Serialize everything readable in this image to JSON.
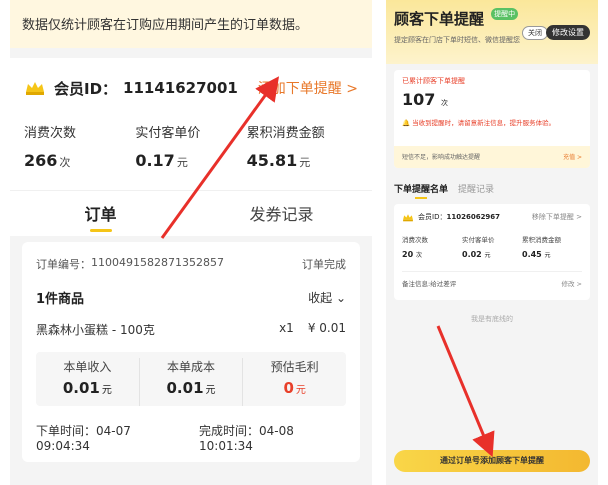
{
  "left": {
    "notice": "数据仅统计顾客在订购应用期间产生的订单数据。",
    "member": {
      "label": "会员ID：",
      "id": "11141627001",
      "add_remind": "添加下单提醒 >"
    },
    "stats": [
      {
        "label": "消费次数",
        "value": "266",
        "unit": "次"
      },
      {
        "label": "实付客单价",
        "value": "0.17",
        "unit": "元"
      },
      {
        "label": "累积消费金额",
        "value": "45.81",
        "unit": "元"
      }
    ],
    "tabs": [
      "订单",
      "发券记录"
    ],
    "order": {
      "number_label": "订单编号：",
      "number": "1100491582871352857",
      "status": "订单完成",
      "goods_title": "1件商品",
      "collapse": "收起 ⌄",
      "item_name": "黑森林小蛋糕 - 100克",
      "item_qty": "x1",
      "item_price": "¥ 0.01",
      "summary": [
        {
          "label": "本单收入",
          "value": "0.01",
          "unit": "元"
        },
        {
          "label": "本单成本",
          "value": "0.01",
          "unit": "元"
        },
        {
          "label": "预估毛利",
          "value": "0",
          "unit": "元"
        }
      ],
      "order_time": "下单时间：04-07 09:04:34",
      "finish_time": "完成时间：04-08 10:01:34"
    }
  },
  "right": {
    "title": "顾客下单提醒",
    "badge": "提醒中",
    "close": "关闭",
    "settings": "修改设置",
    "subtitle": "提定顾客在门店下单时短信、微信提醒您",
    "count_label": "已累计顾客下单提醒",
    "count": "107",
    "count_unit": "次",
    "tip": "当收到提醒时，请留意新注信息，提升服务体验。",
    "sms_note": "短信不足，影响成功触达提醒",
    "sms_charge": "充值 >",
    "tabs": [
      "下单提醒名单",
      "提醒记录"
    ],
    "entry": {
      "label": "会员ID：",
      "id": "11026062967",
      "remove": "移除下单提醒 >",
      "stats": [
        {
          "label": "消费次数",
          "value": "20",
          "unit": "次"
        },
        {
          "label": "实付客单价",
          "value": "0.02",
          "unit": "元"
        },
        {
          "label": "累积消费金额",
          "value": "0.45",
          "unit": "元"
        }
      ],
      "note": "备注信息:给过差评",
      "edit": "修改 >"
    },
    "bottom_hint": "我是有底线的",
    "cta": "通过订单号添加顾客下单提醒"
  },
  "colors": {
    "accent_orange": "#e8782a",
    "accent_red": "#e8402a",
    "accent_yellow": "#f5c518",
    "arrow": "#e8302a"
  }
}
